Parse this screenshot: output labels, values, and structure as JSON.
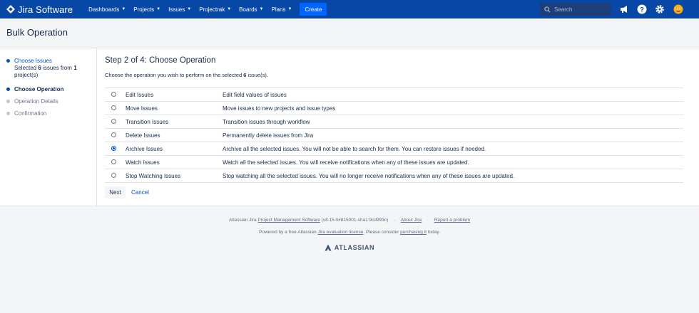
{
  "app": {
    "name": "Jira Software"
  },
  "nav": {
    "items": [
      {
        "label": "Dashboards"
      },
      {
        "label": "Projects"
      },
      {
        "label": "Issues"
      },
      {
        "label": "Projectrak"
      },
      {
        "label": "Boards"
      },
      {
        "label": "Plans"
      }
    ],
    "create_label": "Create",
    "search_placeholder": "Search",
    "icons": [
      "megaphone-icon",
      "help-icon",
      "gear-icon",
      "avatar"
    ]
  },
  "page": {
    "title": "Bulk Operation"
  },
  "wizard": {
    "steps": [
      {
        "label": "Choose Issues",
        "state": "done"
      },
      {
        "label": "Choose Operation",
        "state": "current"
      },
      {
        "label": "Operation Details",
        "state": "pending"
      },
      {
        "label": "Confirmation",
        "state": "pending"
      }
    ],
    "selected_summary": {
      "prefix": "Selected",
      "issue_count": "6",
      "middle": "issues from",
      "project_count": "1",
      "suffix": "project(s)"
    }
  },
  "main": {
    "heading": "Step 2 of 4: Choose Operation",
    "description_prefix": "Choose the operation you wish to perform on the selected",
    "description_count": "6",
    "description_suffix": "issue(s).",
    "operations": [
      {
        "name": "Edit Issues",
        "description": "Edit field values of issues",
        "selected": false
      },
      {
        "name": "Move Issues",
        "description": "Move issues to new projects and issue types",
        "selected": false
      },
      {
        "name": "Transition Issues",
        "description": "Transition issues through workflow",
        "selected": false
      },
      {
        "name": "Delete Issues",
        "description": "Permanently delete issues from Jira",
        "selected": false
      },
      {
        "name": "Archive Issues",
        "description": "Archive all the selected issues. You will not be able to search for them. You can restore issues if needed.",
        "selected": true
      },
      {
        "name": "Watch Issues",
        "description": "Watch all the selected issues. You will receive notifications when any of these issues are updated.",
        "selected": false
      },
      {
        "name": "Stop Watching Issues",
        "description": "Stop watching all the selected issues. You will no longer receive notifications when any of these issues are updated.",
        "selected": false
      }
    ],
    "next_label": "Next",
    "cancel_label": "Cancel"
  },
  "footer": {
    "line1_prefix": "Atlassian Jira",
    "line1_link": "Project Management Software",
    "line1_version": "(v8.15.0#815001-sha1:9cd993c)",
    "about_label": "About Jira",
    "report_label": "Report a problem",
    "line2_prefix": "Powered by a free Atlassian",
    "line2_link": "Jira evaluation license",
    "line2_middle": ". Please consider",
    "line2_link2": "purchasing it",
    "line2_suffix": "today.",
    "brand": "ATLASSIAN"
  },
  "colors": {
    "nav_bg": "#0747a6",
    "create_bg": "#0065ff",
    "link": "#0052cc",
    "step_done": "#0052cc",
    "step_current": "#0747a6",
    "step_pending": "#c1c7d0"
  }
}
